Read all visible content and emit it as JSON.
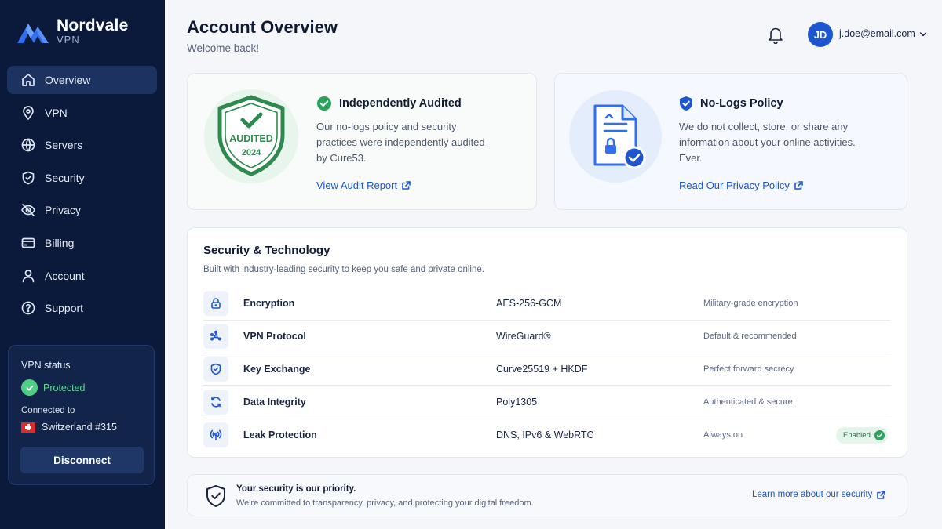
{
  "brand": {
    "name": "Nordvale",
    "sub": "VPN"
  },
  "sidebar": {
    "items": [
      {
        "label": "Overview",
        "icon": "home-icon",
        "active": true
      },
      {
        "label": "VPN",
        "icon": "location-pin-icon"
      },
      {
        "label": "Servers",
        "icon": "globe-icon"
      },
      {
        "label": "Security",
        "icon": "shield-icon"
      },
      {
        "label": "Privacy",
        "icon": "eye-off-icon"
      },
      {
        "label": "Billing",
        "icon": "credit-card-icon"
      },
      {
        "label": "Account",
        "icon": "user-icon"
      },
      {
        "label": "Support",
        "icon": "help-circle-icon"
      }
    ],
    "status": {
      "title": "VPN status",
      "state": "Protected",
      "connected_label": "Connected to",
      "server": "Switzerland #315",
      "disconnect_label": "Disconnect"
    }
  },
  "header": {
    "title": "Account Overview",
    "subtitle": "Welcome back!",
    "avatar_initials": "JD",
    "user_email": "j.doe@email.com"
  },
  "audit_card": {
    "badge_text": "AUDITED",
    "badge_year": "2024",
    "title": "Independently Audited",
    "body_lines": [
      "Our no-logs policy and security",
      "practices were independently audited",
      "by Cure53."
    ],
    "link": "View Audit Report"
  },
  "logs_card": {
    "title": "No-Logs Policy",
    "body_lines": [
      "We do not collect, store, or share any",
      "information about your online activities.",
      "Ever."
    ],
    "link": "Read Our Privacy Policy"
  },
  "security": {
    "title": "Security & Technology",
    "subtitle": "Built with industry-leading security to keep you safe and private online.",
    "rows": [
      {
        "name": "Encryption",
        "value": "AES-256-GCM",
        "note": "Military-grade encryption",
        "icon": "lock-icon"
      },
      {
        "name": "VPN Protocol",
        "value": "WireGuard®",
        "note": "Default & recommended",
        "icon": "network-icon"
      },
      {
        "name": "Key Exchange",
        "value": "Curve25519 + HKDF",
        "note": "Perfect forward secrecy",
        "icon": "shield-check-icon"
      },
      {
        "name": "Data Integrity",
        "value": "Poly1305",
        "note": "Authenticated & secure",
        "icon": "refresh-icon"
      },
      {
        "name": "Leak Protection",
        "value": "DNS, IPv6 & WebRTC",
        "note": "Always on",
        "icon": "signal-icon",
        "pill": "Enabled"
      }
    ]
  },
  "footer": {
    "title": "Your security is our priority.",
    "subtitle": "We're committed to transparency, privacy, and protecting your digital freedom.",
    "link": "Learn more about our security"
  },
  "colors": {
    "sidebar_bg": "#0b1a3a",
    "accent": "#1d56cf",
    "success": "#2aa35c",
    "audit_green": "#2e8a4e"
  }
}
